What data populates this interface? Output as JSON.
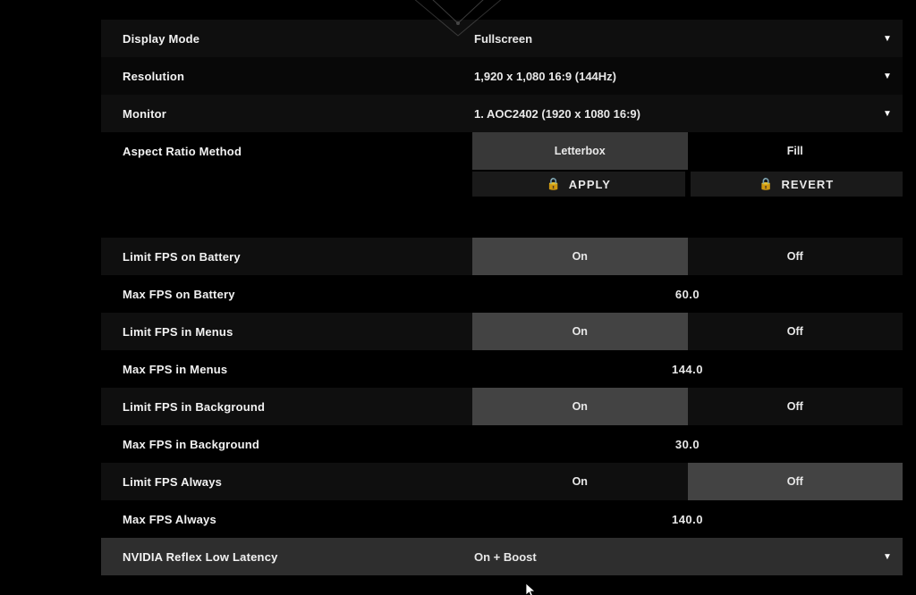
{
  "settings": {
    "display_mode": {
      "label": "Display Mode",
      "value": "Fullscreen"
    },
    "resolution": {
      "label": "Resolution",
      "value": "1,920 x 1,080 16:9 (144Hz)"
    },
    "monitor": {
      "label": "Monitor",
      "value": "1. AOC2402 (1920 x  1080 16:9)"
    },
    "aspect_ratio": {
      "label": "Aspect Ratio Method",
      "opt_a": "Letterbox",
      "opt_b": "Fill"
    },
    "limit_fps_battery": {
      "label": "Limit FPS on Battery",
      "opt_a": "On",
      "opt_b": "Off"
    },
    "max_fps_battery": {
      "label": "Max FPS on Battery",
      "value": "60.0"
    },
    "limit_fps_menus": {
      "label": "Limit FPS in Menus",
      "opt_a": "On",
      "opt_b": "Off"
    },
    "max_fps_menus": {
      "label": "Max FPS in Menus",
      "value": "144.0"
    },
    "limit_fps_bg": {
      "label": "Limit FPS in Background",
      "opt_a": "On",
      "opt_b": "Off"
    },
    "max_fps_bg": {
      "label": "Max FPS in Background",
      "value": "30.0"
    },
    "limit_fps_always": {
      "label": "Limit FPS Always",
      "opt_a": "On",
      "opt_b": "Off"
    },
    "max_fps_always": {
      "label": "Max FPS Always",
      "value": "140.0"
    },
    "nvidia_reflex": {
      "label": "NVIDIA Reflex Low Latency",
      "value": "On + Boost"
    }
  },
  "actions": {
    "apply": "APPLY",
    "revert": "REVERT"
  }
}
